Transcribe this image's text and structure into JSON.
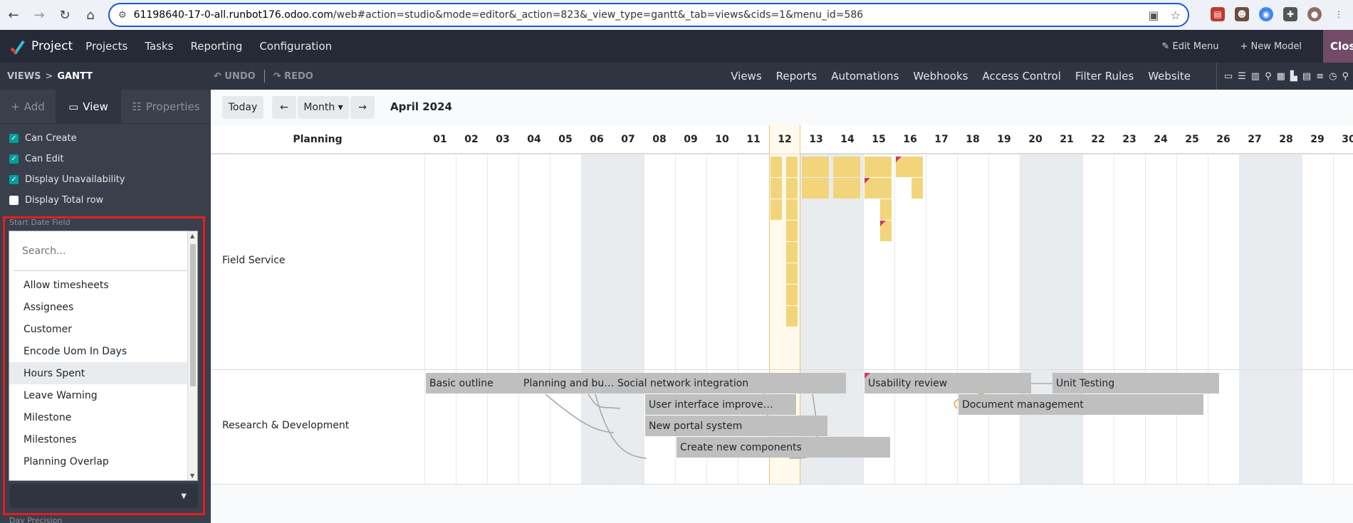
{
  "browser": {
    "url_host": "61198640-17-0-all.runbot176.odoo.com",
    "url_path": "/web#action=studio&mode=editor&_action=823&_view_type=gantt&_tab=views&cids=1&menu_id=586"
  },
  "navbar": {
    "app_name": "Project",
    "menu": [
      "Projects",
      "Tasks",
      "Reporting",
      "Configuration"
    ],
    "edit_menu": "✎ Edit Menu",
    "new_model": "+ New Model",
    "close": "Clos"
  },
  "studio_bar": {
    "crumb_root": "VIEWS",
    "crumb_sep": ">",
    "crumb_current": "GANTT",
    "undo": "↶ UNDO",
    "redo": "↷ REDO",
    "menus": [
      "Views",
      "Reports",
      "Automations",
      "Webhooks",
      "Access Control",
      "Filter Rules",
      "Website"
    ]
  },
  "sidebar": {
    "tabs": [
      {
        "icon": "+",
        "label": "Add"
      },
      {
        "icon": "▭",
        "label": "View"
      },
      {
        "icon": "☷",
        "label": "Properties"
      }
    ],
    "options": [
      {
        "label": "Can Create",
        "checked": true
      },
      {
        "label": "Can Edit",
        "checked": true
      },
      {
        "label": "Display Unavailability",
        "checked": true
      },
      {
        "label": "Display Total row",
        "checked": false
      }
    ],
    "start_date_label": "Start Date Field",
    "dropdown": {
      "placeholder": "Search...",
      "items": [
        "Allow timesheets",
        "Assignees",
        "Customer",
        "Encode Uom In Days",
        "Hours Spent",
        "Leave Warning",
        "Milestone",
        "Milestones",
        "Planning Overlap",
        "Planning Overlap"
      ],
      "highlighted": "Hours Spent"
    },
    "select_caret": "▼",
    "day_precision_label": "Day Precision"
  },
  "controls": {
    "today": "Today",
    "prev": "←",
    "scale": "Month ▾",
    "next": "→",
    "period": "April 2024"
  },
  "gantt": {
    "planning_title": "Planning",
    "days": [
      "01",
      "02",
      "03",
      "04",
      "05",
      "06",
      "07",
      "08",
      "09",
      "10",
      "11",
      "12",
      "13",
      "14",
      "15",
      "16",
      "17",
      "18",
      "19",
      "20",
      "21",
      "22",
      "23",
      "24",
      "25",
      "26",
      "27",
      "28",
      "29",
      "30"
    ],
    "weekend_days": [
      "06",
      "07",
      "13",
      "14",
      "20",
      "21",
      "27",
      "28"
    ],
    "today_day": "12",
    "rows": [
      "Field Service",
      "Research & Development"
    ],
    "tasks": [
      {
        "name": "Basic outline",
        "start": 1,
        "end": 3.4,
        "lane": 0
      },
      {
        "name": "Planning and bu…",
        "start": 4,
        "end": 6.9,
        "lane": 0
      },
      {
        "name": "Social network integration",
        "start": 7,
        "end": 13.5,
        "lane": 0
      },
      {
        "name": "Usability review",
        "start": 15,
        "end": 19.4,
        "lane": 0,
        "flag": true
      },
      {
        "name": "Unit Testing",
        "start": 21,
        "end": 25.4,
        "lane": 0
      },
      {
        "name": "User interface improve…",
        "start": 8,
        "end": 11.9,
        "lane": 1
      },
      {
        "name": "Document management",
        "start": 18,
        "end": 24.9,
        "lane": 1
      },
      {
        "name": "New portal system",
        "start": 8,
        "end": 12.9,
        "lane": 2
      },
      {
        "name": "Create new components",
        "start": 9,
        "end": 14.9,
        "lane": 3
      }
    ],
    "field_service_pills": [
      {
        "start": 12,
        "span": 0.4,
        "lane": 0
      },
      {
        "start": 12.5,
        "span": 0.4,
        "lane": 0
      },
      {
        "start": 13,
        "span": 0.9,
        "lane": 0
      },
      {
        "start": 14,
        "span": 0.9,
        "lane": 0
      },
      {
        "start": 15,
        "span": 0.9,
        "lane": 0
      },
      {
        "start": 16,
        "span": 0.9,
        "lane": 0,
        "flag": true
      },
      {
        "start": 12,
        "span": 0.4,
        "lane": 1
      },
      {
        "start": 12.5,
        "span": 0.4,
        "lane": 1
      },
      {
        "start": 13,
        "span": 0.9,
        "lane": 1
      },
      {
        "start": 14,
        "span": 0.9,
        "lane": 1
      },
      {
        "start": 15,
        "span": 0.9,
        "lane": 1,
        "flag": true
      },
      {
        "start": 16.5,
        "span": 0.4,
        "lane": 1
      },
      {
        "start": 12,
        "span": 0.4,
        "lane": 2
      },
      {
        "start": 12.5,
        "span": 0.4,
        "lane": 2
      },
      {
        "start": 15.5,
        "span": 0.4,
        "lane": 2
      },
      {
        "start": 12.5,
        "span": 0.4,
        "lane": 3
      },
      {
        "start": 15.5,
        "span": 0.4,
        "lane": 3,
        "flag": true
      },
      {
        "start": 12.5,
        "span": 0.4,
        "lane": 4
      },
      {
        "start": 12.5,
        "span": 0.4,
        "lane": 5
      },
      {
        "start": 12.5,
        "span": 0.4,
        "lane": 6
      },
      {
        "start": 12.5,
        "span": 0.4,
        "lane": 7
      }
    ]
  }
}
